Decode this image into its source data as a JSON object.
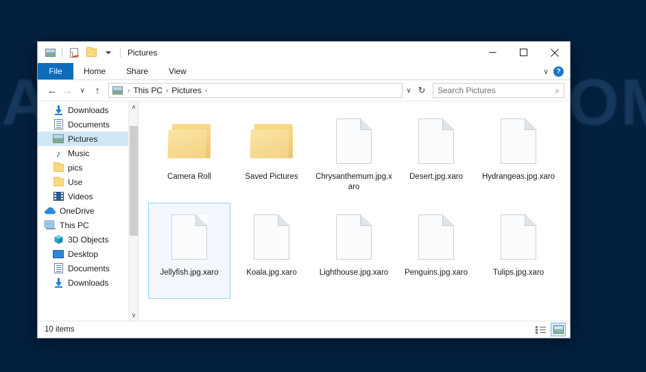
{
  "window": {
    "title": "Pictures",
    "quick_access": [
      {
        "name": "pictures-icon",
        "label": "Pictures"
      },
      {
        "name": "properties-icon",
        "label": "Properties"
      },
      {
        "name": "new-folder-icon",
        "label": "New folder"
      }
    ],
    "controls": {
      "minimize": "—",
      "maximize": "□",
      "close": "✕"
    }
  },
  "ribbon": {
    "tabs": [
      {
        "label": "File",
        "active": true
      },
      {
        "label": "Home",
        "active": false
      },
      {
        "label": "Share",
        "active": false
      },
      {
        "label": "View",
        "active": false
      }
    ],
    "expand_label": "∨",
    "help_label": "?"
  },
  "address": {
    "back": "←",
    "forward": "→",
    "recent": "∨",
    "up": "↑",
    "breadcrumbs": [
      "This PC",
      "Pictures"
    ],
    "separator": "›",
    "dropdown": "∨",
    "refresh": "↻"
  },
  "search": {
    "placeholder": "Search Pictures",
    "value": "",
    "icon": "⌕"
  },
  "sidebar": {
    "items": [
      {
        "label": "Downloads",
        "icon": "download-icon",
        "indent": 1,
        "pinned": true,
        "selected": false
      },
      {
        "label": "Documents",
        "icon": "documents-icon",
        "indent": 1,
        "pinned": true,
        "selected": false
      },
      {
        "label": "Pictures",
        "icon": "pictures-icon",
        "indent": 1,
        "pinned": true,
        "selected": true
      },
      {
        "label": "Music",
        "icon": "music-icon",
        "indent": 1,
        "pinned": false,
        "selected": false
      },
      {
        "label": "pics",
        "icon": "folder-icon",
        "indent": 1,
        "pinned": false,
        "selected": false
      },
      {
        "label": "Use",
        "icon": "folder-icon",
        "indent": 1,
        "pinned": false,
        "selected": false
      },
      {
        "label": "Videos",
        "icon": "videos-icon",
        "indent": 1,
        "pinned": false,
        "selected": false
      },
      {
        "label": "OneDrive",
        "icon": "cloud-icon",
        "indent": 0,
        "pinned": false,
        "selected": false
      },
      {
        "label": "This PC",
        "icon": "computer-icon",
        "indent": 0,
        "pinned": false,
        "selected": false
      },
      {
        "label": "3D Objects",
        "icon": "cube-icon",
        "indent": 1,
        "pinned": false,
        "selected": false
      },
      {
        "label": "Desktop",
        "icon": "desktop-icon",
        "indent": 1,
        "pinned": false,
        "selected": false
      },
      {
        "label": "Documents",
        "icon": "documents-icon",
        "indent": 1,
        "pinned": false,
        "selected": false
      },
      {
        "label": "Downloads",
        "icon": "download-icon",
        "indent": 1,
        "pinned": false,
        "selected": false
      }
    ],
    "scroll_up": "∧",
    "scroll_down": "∨"
  },
  "files": [
    {
      "name": "Camera Roll",
      "type": "folder",
      "selected": false
    },
    {
      "name": "Saved Pictures",
      "type": "folder",
      "selected": false
    },
    {
      "name": "Chrysanthemum.jpg.xaro",
      "type": "file",
      "selected": false
    },
    {
      "name": "Desert.jpg.xaro",
      "type": "file",
      "selected": false
    },
    {
      "name": "Hydrangeas.jpg.xaro",
      "type": "file",
      "selected": false
    },
    {
      "name": "Jellyfish.jpg.xaro",
      "type": "file",
      "selected": true
    },
    {
      "name": "Koala.jpg.xaro",
      "type": "file",
      "selected": false
    },
    {
      "name": "Lighthouse.jpg.xaro",
      "type": "file",
      "selected": false
    },
    {
      "name": "Penguins.jpg.xaro",
      "type": "file",
      "selected": false
    },
    {
      "name": "Tulips.jpg.xaro",
      "type": "file",
      "selected": false
    }
  ],
  "status": {
    "item_count": "10 items",
    "views": [
      {
        "name": "details-view",
        "active": false
      },
      {
        "name": "large-icons-view",
        "active": true
      }
    ]
  },
  "desktop": {
    "watermark_line1": "ANTISPYWARE.COM",
    "watermark_line2": ""
  },
  "colors": {
    "accent": "#0b6cbb",
    "selection": "#cfe8f7",
    "folder": "#fcd980",
    "desktop": "#03203f"
  }
}
